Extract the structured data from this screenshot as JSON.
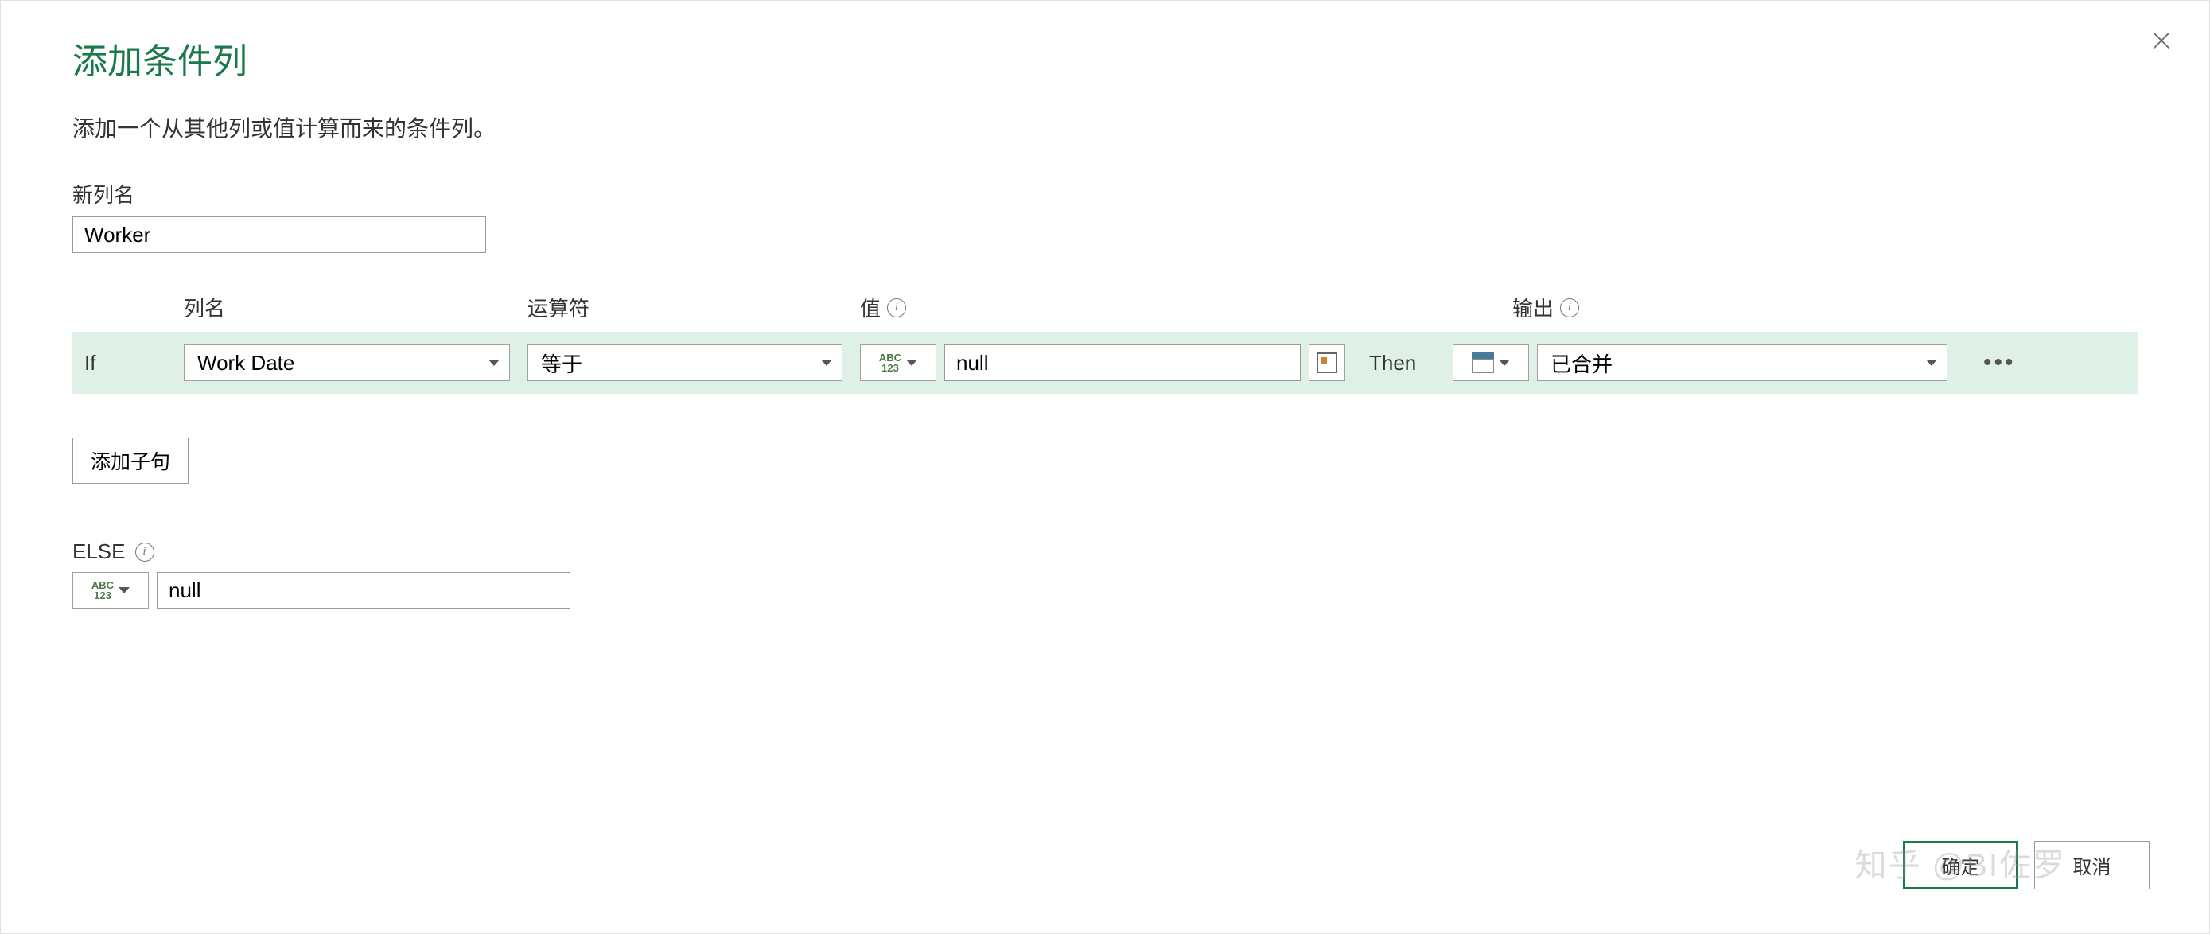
{
  "dialog": {
    "title": "添加条件列",
    "subtitle": "添加一个从其他列或值计算而来的条件列。",
    "close_label": "close"
  },
  "new_column": {
    "label": "新列名",
    "value": "Worker"
  },
  "headers": {
    "column_name": "列名",
    "operator": "运算符",
    "value": "值",
    "output": "输出"
  },
  "condition": {
    "if_label": "If",
    "column": "Work Date",
    "operator": "等于",
    "value_type": "ABC123",
    "value": "null",
    "then_label": "Then",
    "output_type": "column",
    "output": "已合并"
  },
  "add_clause_label": "添加子句",
  "else": {
    "label": "ELSE",
    "type": "ABC123",
    "value": "null"
  },
  "buttons": {
    "ok": "确定",
    "cancel": "取消"
  },
  "watermark": "知乎 @BI佐罗"
}
